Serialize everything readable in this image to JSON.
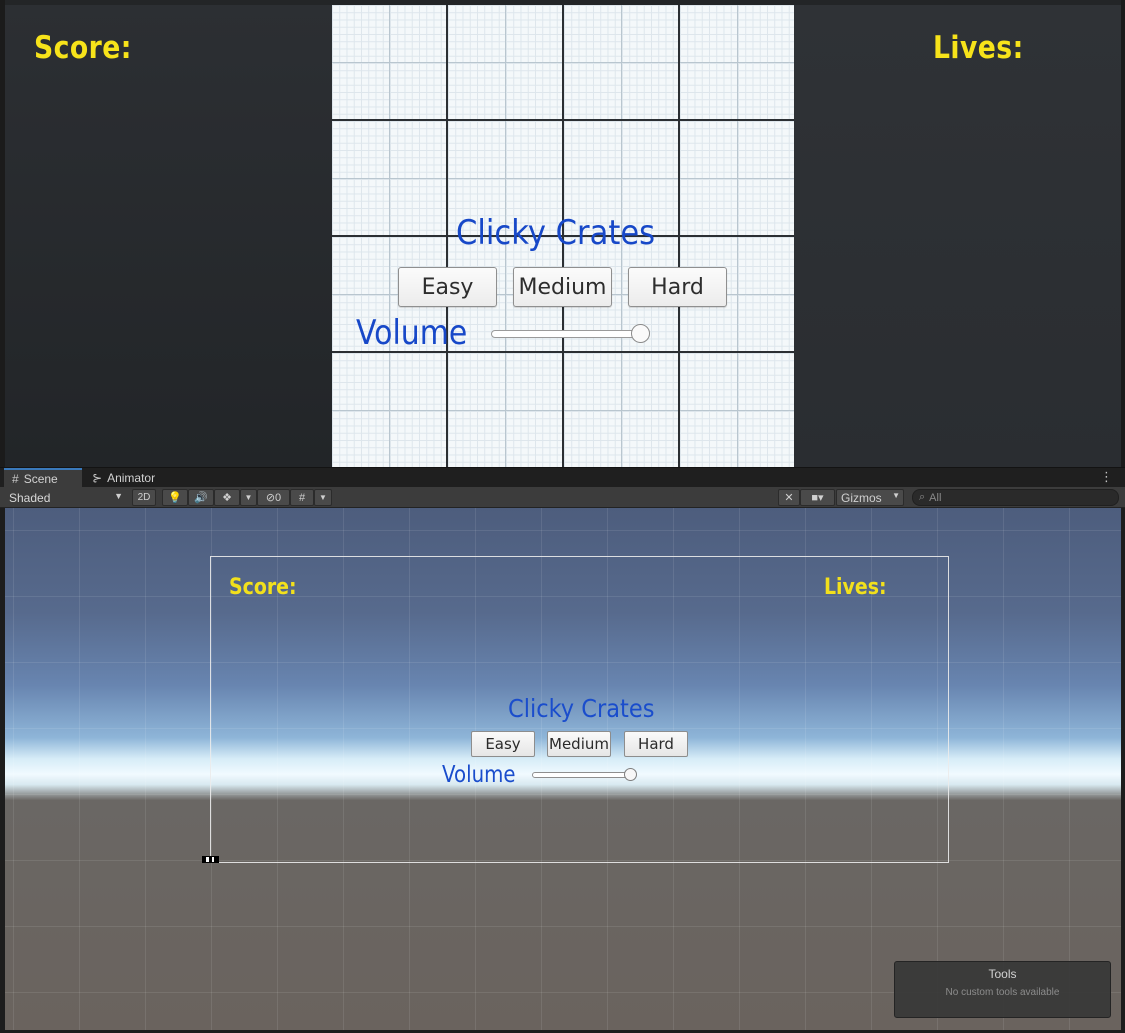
{
  "game": {
    "score_label": "Score:",
    "lives_label": "Lives:",
    "title": "Clicky Crates",
    "buttons": [
      "Easy",
      "Medium",
      "Hard"
    ],
    "volume_label": "Volume",
    "volume_value": 1.0
  },
  "tabs": {
    "scene_label": "Scene",
    "animator_label": "Animator",
    "menu_icon": "kebab-menu-icon"
  },
  "toolbar": {
    "shading_mode": "Shaded",
    "two_d_label": "2D",
    "hidden_count": "0",
    "gizmos_label": "Gizmos",
    "search_placeholder": "All"
  },
  "scene": {
    "score_label": "Score:",
    "lives_label": "Lives:",
    "title": "Clicky Crates",
    "buttons": [
      "Easy",
      "Medium",
      "Hard"
    ],
    "volume_label": "Volume",
    "volume_value": 1.0
  },
  "tools_overlay": {
    "title": "Tools",
    "empty_message": "No custom tools available"
  },
  "colors": {
    "label_yellow": "#f7e31a",
    "title_blue": "#1748c8",
    "tab_accent": "#3a79bb"
  }
}
